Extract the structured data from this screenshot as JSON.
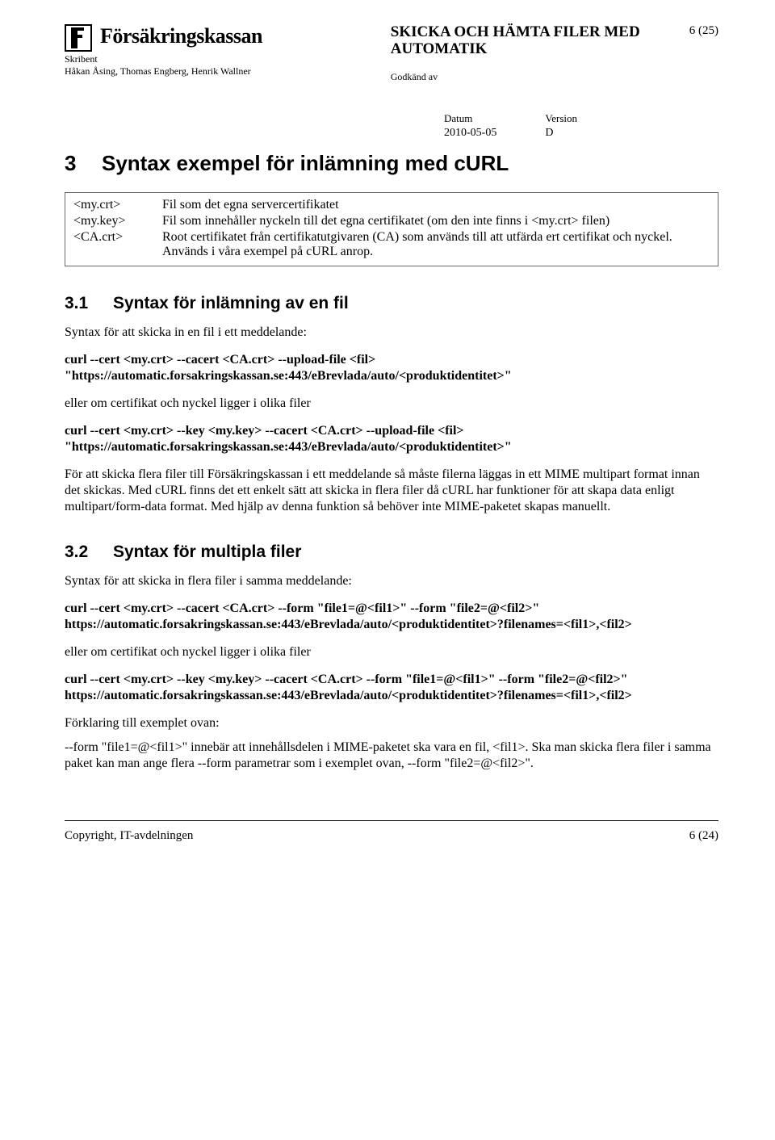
{
  "header": {
    "brand": "Försäkringskassan",
    "doc_title": "SKICKA OCH HÄMTA FILER MED AUTOMATIK",
    "page_num": "6 (25)",
    "skribent_label": "Skribent",
    "skribent_val": "Håkan Åsing, Thomas Engberg, Henrik Wallner",
    "godkand_label": "Godkänd av",
    "datum_label": "Datum",
    "datum_val": "2010-05-05",
    "version_label": "Version",
    "version_val": "D"
  },
  "h1_num": "3",
  "h1_text": "Syntax exempel för inlämning med cURL",
  "defs": [
    {
      "k": "<my.crt>",
      "v": "Fil som det egna servercertifikatet"
    },
    {
      "k": "<my.key>",
      "v": "Fil som innehåller nyckeln till det egna certifikatet (om den inte finns i <my.crt> filen)"
    },
    {
      "k": "<CA.crt>",
      "v": "Root certifikatet från certifikatutgivaren (CA) som används till att utfärda ert certifikat och nyckel. Används i våra exempel på cURL anrop."
    }
  ],
  "s31": {
    "num": "3.1",
    "title": "Syntax för inlämning av en fil",
    "intro": "Syntax för att skicka in en fil i ett meddelande:",
    "cmd1": "curl --cert <my.crt> --cacert <CA.crt> --upload-file <fil> \"https://automatic.forsakringskassan.se:443/eBrevlada/auto/<produktidentitet>\"",
    "or": "eller om certifikat och nyckel ligger i olika filer",
    "cmd2": "curl --cert <my.crt> --key <my.key> --cacert <CA.crt> --upload-file <fil> \"https://automatic.forsakringskassan.se:443/eBrevlada/auto/<produktidentitet>\"",
    "para": "För att skicka flera filer till Försäkringskassan i ett meddelande så måste filerna läggas in ett MIME multipart format innan det skickas. Med cURL finns det ett enkelt sätt att skicka in flera filer då cURL har funktioner för att skapa data enligt multipart/form-data format. Med hjälp av denna funktion så behöver inte MIME-paketet skapas manuellt."
  },
  "s32": {
    "num": "3.2",
    "title": "Syntax för multipla filer",
    "intro": "Syntax för att skicka in flera filer i samma meddelande:",
    "cmd1": "curl --cert <my.crt> --cacert <CA.crt> --form \"file1=@<fil1>\" --form \"file2=@<fil2>\" https://automatic.forsakringskassan.se:443/eBrevlada/auto/<produktidentitet>?filenames=<fil1>,<fil2>",
    "or": "eller om certifikat och nyckel ligger i olika filer",
    "cmd2": "curl --cert <my.crt> --key <my.key> --cacert <CA.crt> --form \"file1=@<fil1>\" --form \"file2=@<fil2>\" https://automatic.forsakringskassan.se:443/eBrevlada/auto/<produktidentitet>?filenames=<fil1>,<fil2>",
    "explain_label": "Förklaring till exemplet ovan:",
    "explain": "--form \"file1=@<fil1>\" innebär att innehållsdelen i MIME-paketet ska vara en fil, <fil1>. Ska man skicka flera filer i samma paket kan man ange flera --form parametrar som i exemplet ovan, --form \"file2=@<fil2>\"."
  },
  "footer": {
    "left": "Copyright, IT-avdelningen",
    "right": "6 (24)"
  }
}
